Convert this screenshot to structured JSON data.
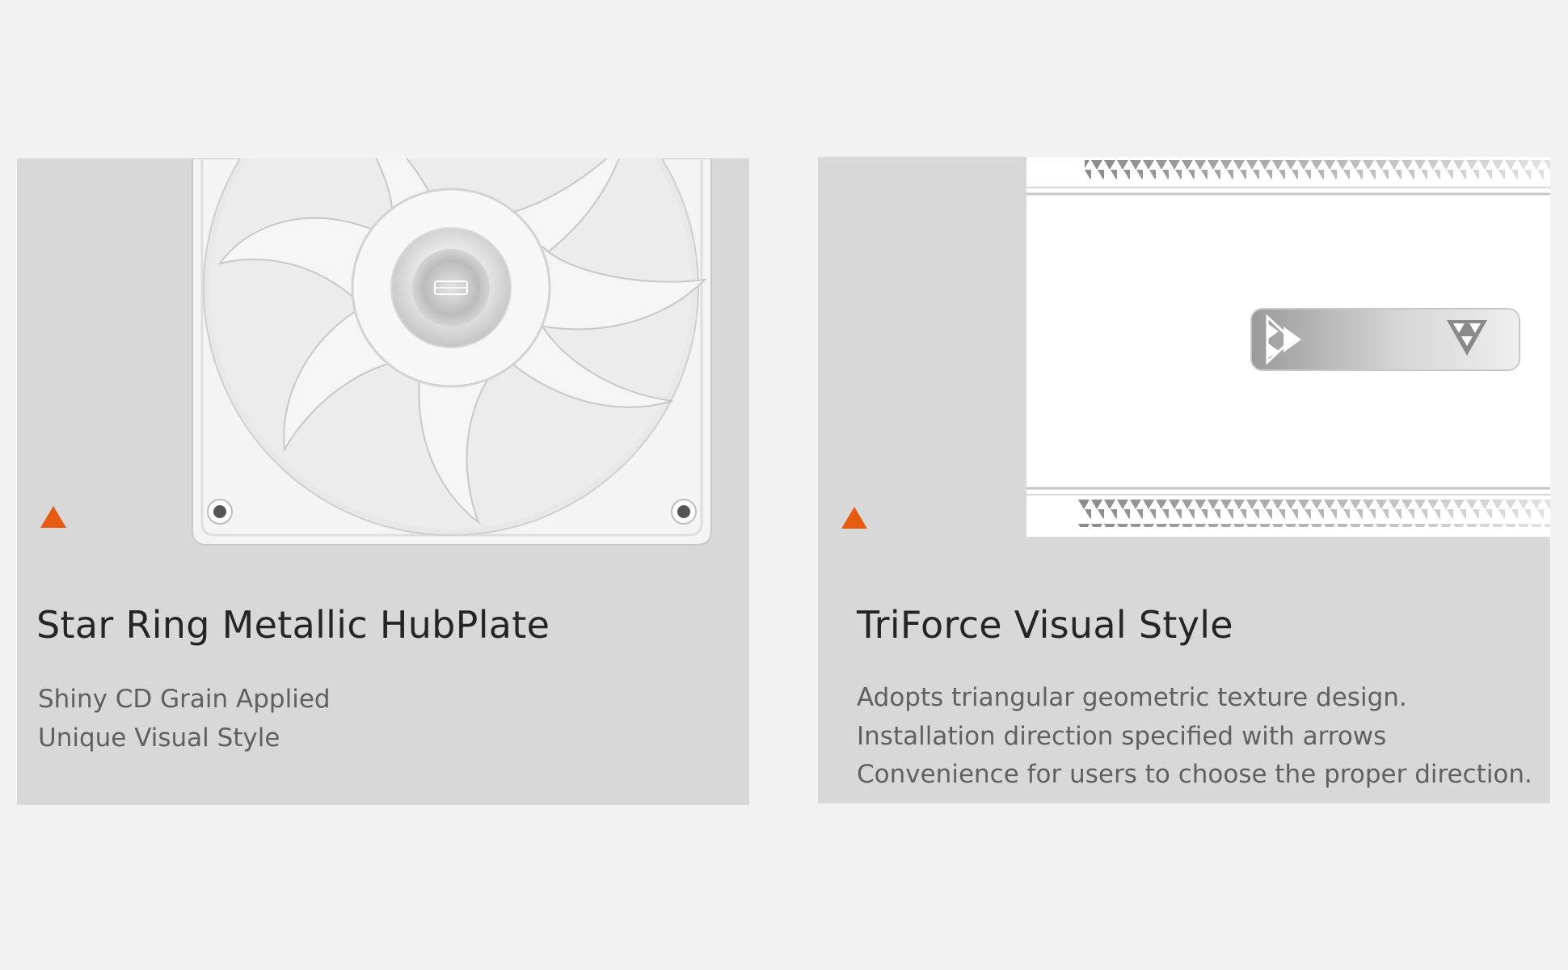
{
  "features": [
    {
      "title": "Star Ring Metallic HubPlate",
      "lines": [
        "Shiny CD Grain Applied",
        "Unique Visual Style"
      ],
      "image_icon": "fan-with-metallic-hub",
      "marker_icon": "orange-triangle-icon"
    },
    {
      "title": "TriForce Visual Style",
      "lines": [
        "Adopts triangular geometric texture design.",
        "Installation direction specified with arrows",
        "Convenience for users to choose the proper direction."
      ],
      "image_icon": "fan-frame-triangle-texture",
      "marker_icon": "orange-triangle-icon"
    }
  ],
  "colors": {
    "page_background": "#f2f2f2",
    "card_background": "#d8d8d8",
    "accent": "#e55b12",
    "title_text": "#252525",
    "body_text": "#606060"
  }
}
